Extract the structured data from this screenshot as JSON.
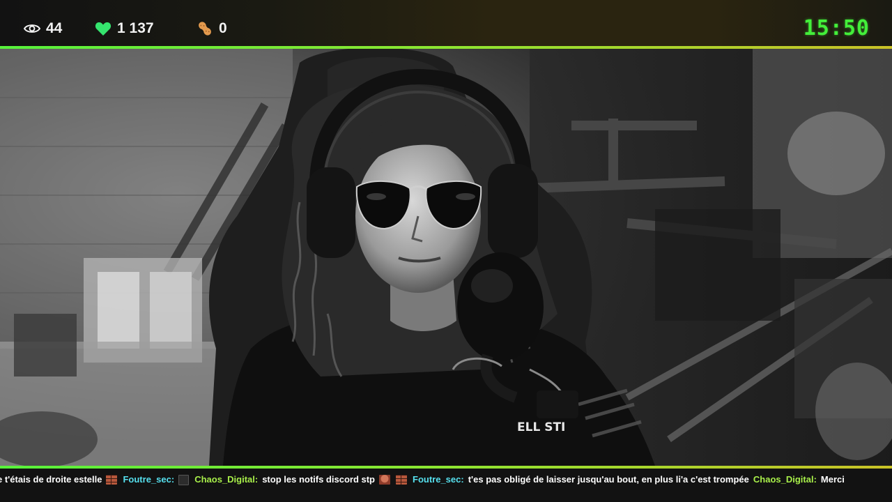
{
  "header": {
    "viewers": {
      "icon": "eye-icon",
      "count": "44"
    },
    "followers": {
      "icon": "heart-icon",
      "count": "1 137",
      "color": "#35e46e"
    },
    "bits": {
      "icon": "peanut-icon",
      "count": "0",
      "color": "#e39a4e"
    },
    "clock": "15:50",
    "clock_color": "#43ef3a",
    "accent_line": [
      "#57f23b",
      "#c9c227"
    ]
  },
  "camera": {
    "description_icon": "webcam-feed",
    "shirt_text": "ELL STI"
  },
  "ticker": {
    "items": [
      {
        "type": "msg",
        "text": "e t'étais de droite estelle"
      },
      {
        "type": "emote",
        "emote": "brick-emote"
      },
      {
        "type": "user",
        "name": "Foutre_sec:",
        "color": "#56e0ee"
      },
      {
        "type": "emote",
        "emote": "box-emote"
      },
      {
        "type": "user",
        "name": "Chaos_Digital:",
        "color": "#a8ef4a"
      },
      {
        "type": "msg",
        "text": "stop les notifs discord stp"
      },
      {
        "type": "emote",
        "emote": "hand-emote"
      },
      {
        "type": "emote",
        "emote": "brick-emote"
      },
      {
        "type": "user",
        "name": "Foutre_sec:",
        "color": "#56e0ee"
      },
      {
        "type": "msg",
        "text": "t'es pas obligé de laisser jusqu'au bout, en plus li'a c'est trompée"
      },
      {
        "type": "user",
        "name": "Chaos_Digital:",
        "color": "#a8ef4a"
      },
      {
        "type": "msg",
        "text": "Merci"
      }
    ]
  }
}
